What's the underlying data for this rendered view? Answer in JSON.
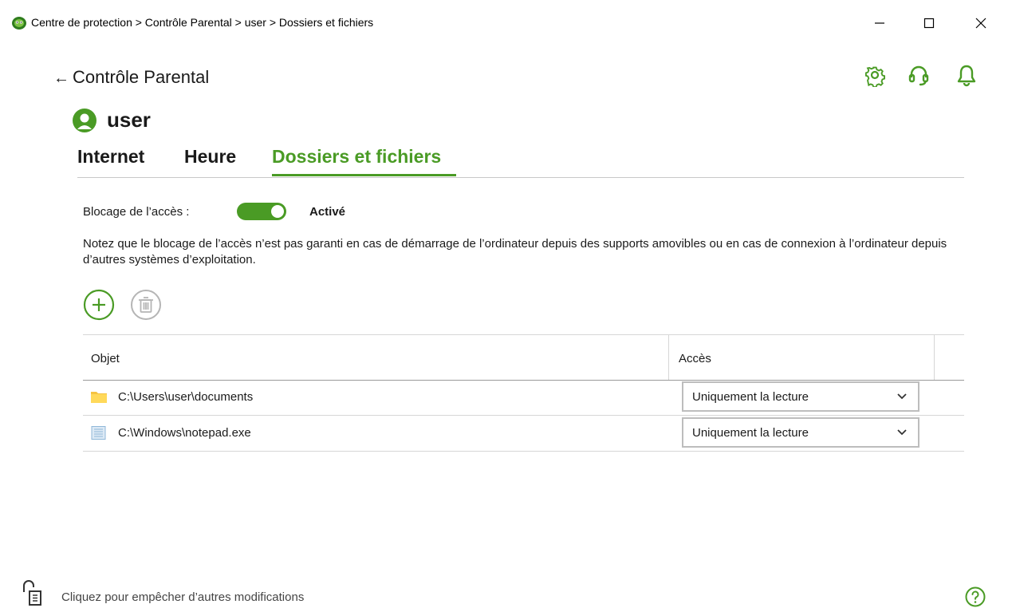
{
  "window": {
    "title": "Centre de protection > Contrôle Parental > user > Dossiers et fichiers",
    "logo_icon": "dr-web-spider-logo",
    "controls": [
      "minimize-icon",
      "maximize-icon",
      "close-icon"
    ]
  },
  "header": {
    "back_arrow": "←",
    "back_label": "Contrôle Parental",
    "icons": [
      "gear-icon",
      "headset-icon",
      "bell-icon"
    ]
  },
  "user": {
    "name": "user",
    "avatar_icon": "user-avatar-icon"
  },
  "tabs": [
    {
      "label": "Internet",
      "active": false
    },
    {
      "label": "Heure",
      "active": false
    },
    {
      "label": "Dossiers et fichiers",
      "active": true
    }
  ],
  "access_blocking": {
    "label": "Blocage de l’accès :",
    "enabled": true,
    "state_label": "Activé"
  },
  "notice": "Notez que le blocage de l’accès n’est pas garanti en cas de démarrage de l’ordinateur depuis des supports amovibles ou en cas de connexion à l’ordinateur depuis d’autres systèmes d’exploitation.",
  "toolbar": {
    "add_icon": "plus-circle-icon",
    "delete_icon": "trash-circle-icon"
  },
  "table": {
    "columns": [
      "Objet",
      "Accès"
    ],
    "rows": [
      {
        "icon": "folder-icon",
        "path": "C:\\Users\\user\\documents",
        "access": "Uniquement la lecture"
      },
      {
        "icon": "file-icon",
        "path": "C:\\Windows\\notepad.exe",
        "access": "Uniquement la lecture"
      }
    ]
  },
  "footer": {
    "lock_text": "Cliquez pour empêcher d’autres modifications",
    "lock_icon": "unlocked-padlock-icon",
    "help_icon": "help-icon"
  },
  "colors": {
    "accent": "#4a9b25",
    "folder": "#f5c342",
    "file": "#8fb7d8"
  }
}
